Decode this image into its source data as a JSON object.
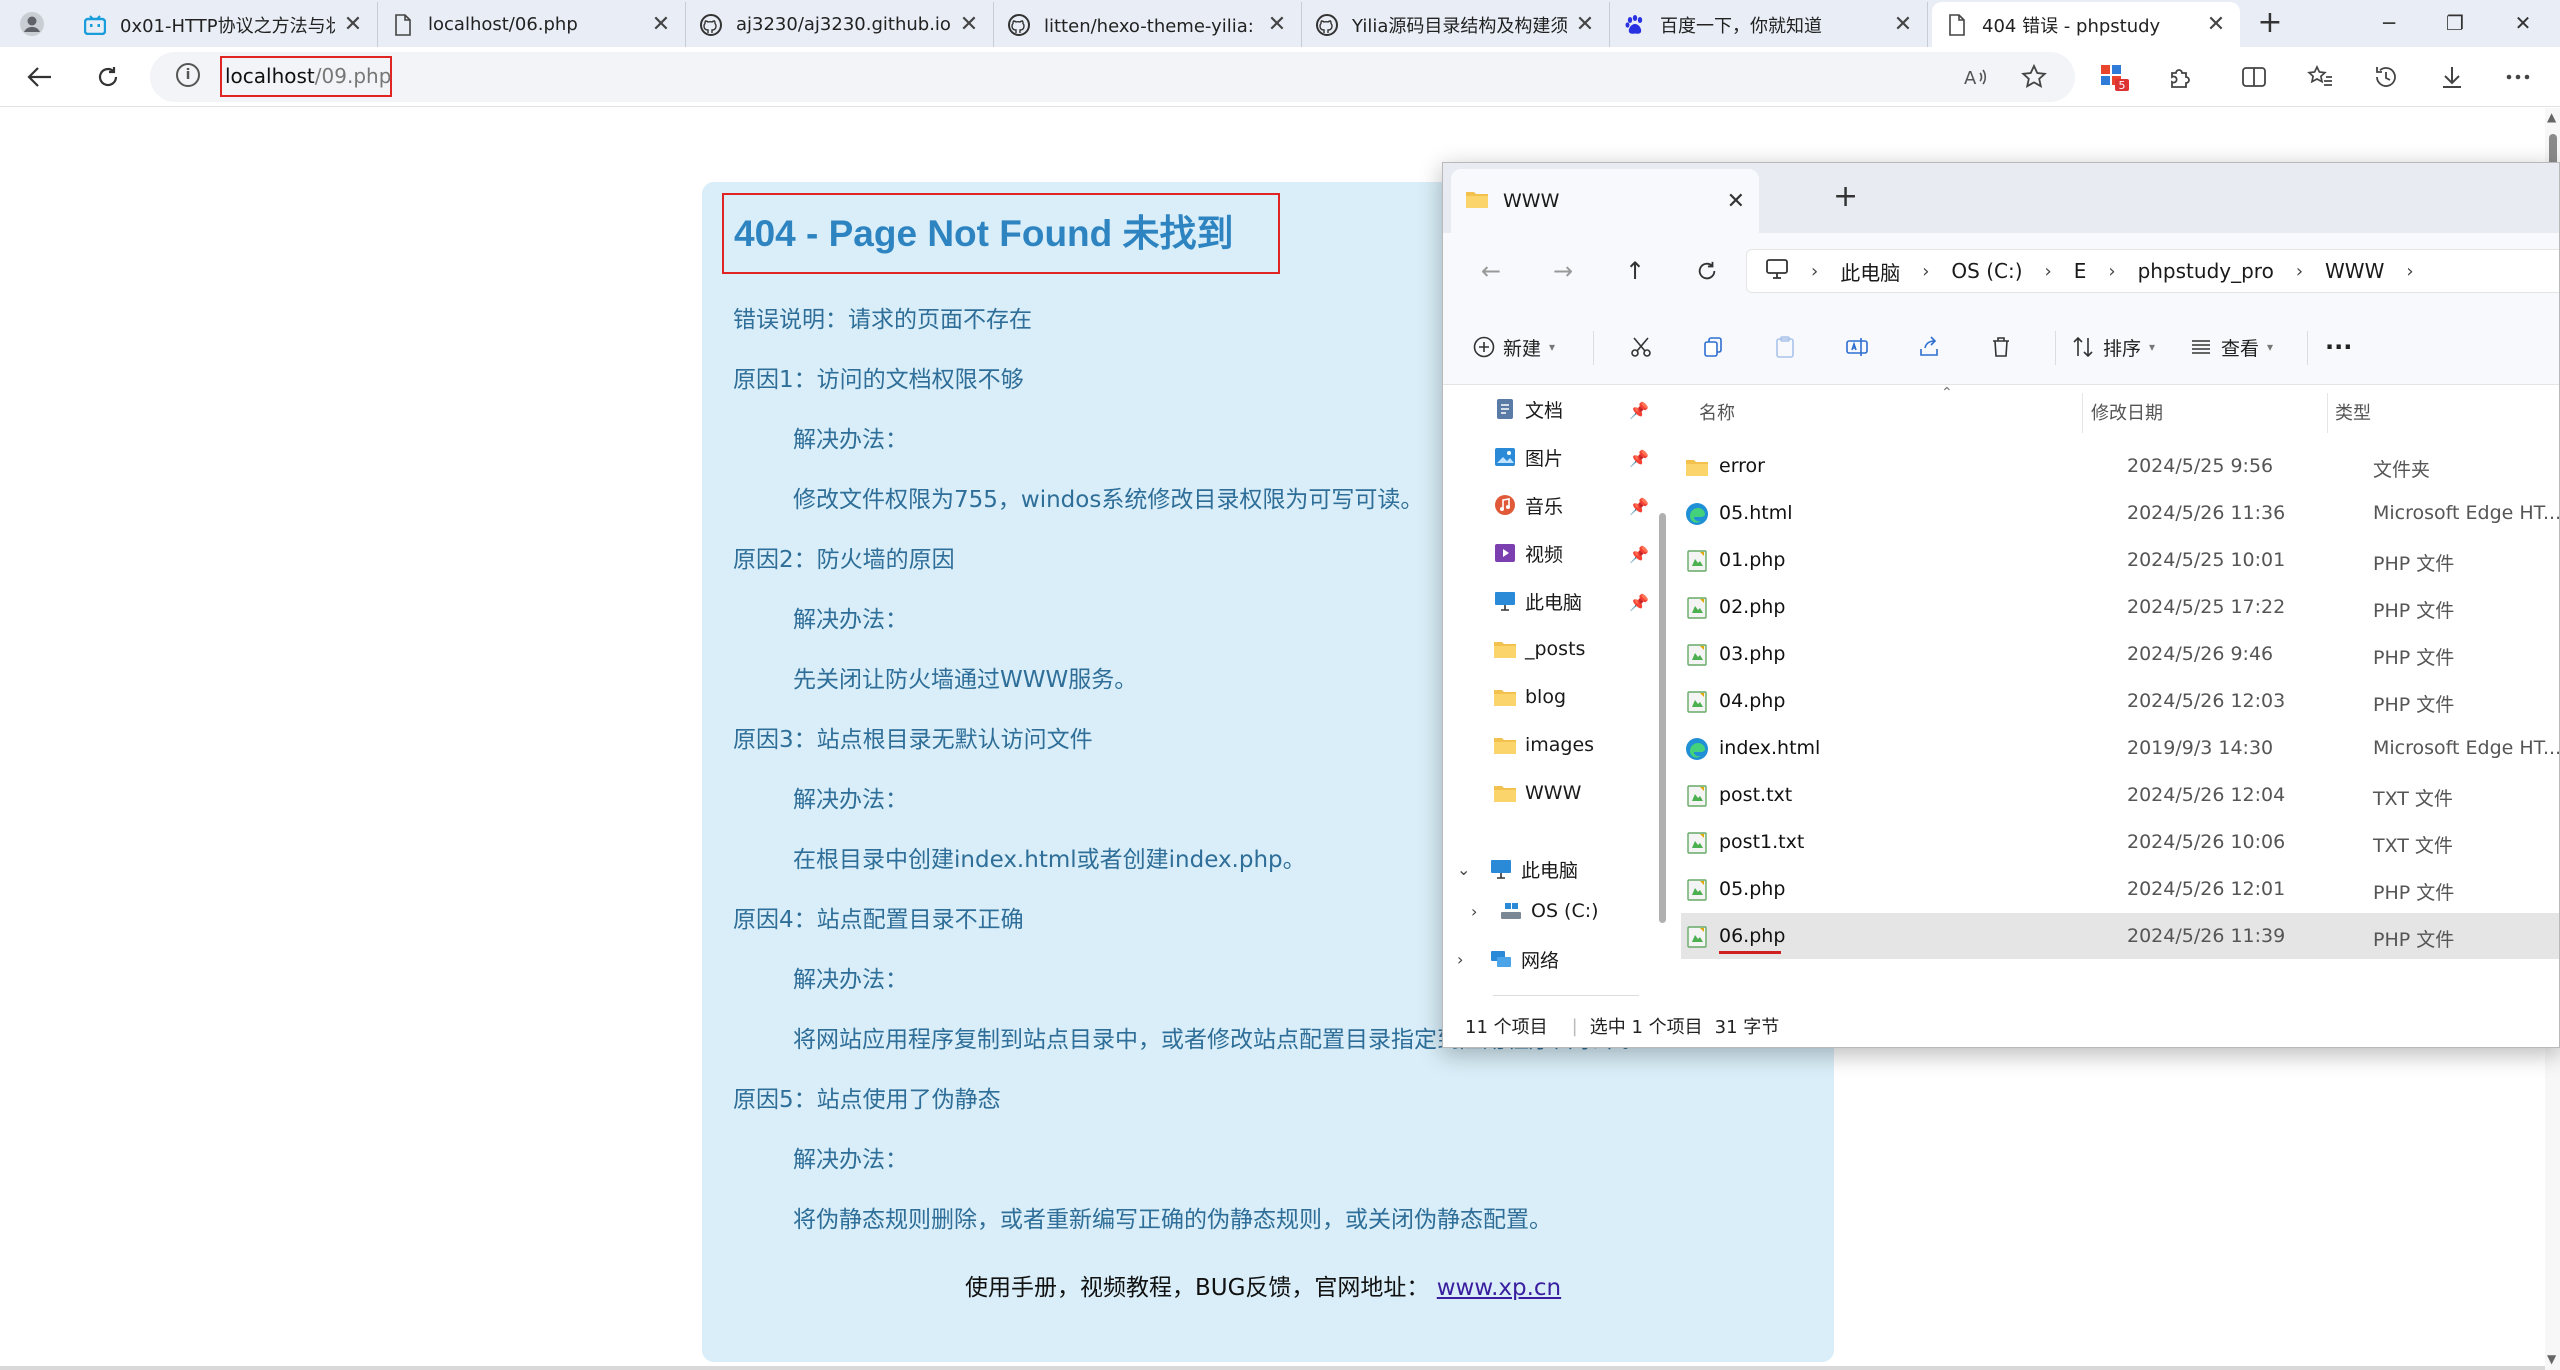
{
  "browser": {
    "tabs": [
      {
        "title": "0x01-HTTP协议之方法与状",
        "icon": "bilibili-icon"
      },
      {
        "title": "localhost/06.php",
        "icon": "page-icon"
      },
      {
        "title": "aj3230/aj3230.github.io: M",
        "icon": "github-icon"
      },
      {
        "title": "litten/hexo-theme-yilia: 一",
        "icon": "github-icon"
      },
      {
        "title": "Yilia源码目录结构及构建须",
        "icon": "github-icon"
      },
      {
        "title": "百度一下，你就知道",
        "icon": "baidu-icon"
      },
      {
        "title": "404 错误 - phpstudy",
        "icon": "page-icon",
        "active": true
      }
    ],
    "new_tab": "+",
    "window_controls": {
      "minimize": "─",
      "restore": "❐",
      "close": "✕"
    },
    "url": {
      "host": "localhost",
      "path": "/09.php"
    },
    "extension_badge": "5"
  },
  "page": {
    "title": "404 - Page Not Found 未找到",
    "lines": [
      "错误说明：请求的页面不存在",
      "原因1：访问的文档权限不够",
      "解决办法：",
      "修改文件权限为755，windos系统修改目录权限为可写可读。",
      "原因2：防火墙的原因",
      "解决办法：",
      "先关闭让防火墙通过WWW服务。",
      "原因3：站点根目录无默认访问文件",
      "解决办法：",
      "在根目录中创建index.html或者创建index.php。",
      "原因4：站点配置目录不正确",
      "解决办法：",
      "将网站应用程序复制到站点目录中，或者修改站点配置目录指定到应用程序目录中。",
      "原因5：站点使用了伪静态",
      "解决办法：",
      "将伪静态规则删除，或者重新编写正确的伪静态规则，或关闭伪静态配置。"
    ],
    "footer_text": "使用手册，视频教程，BUG反馈，官网地址：",
    "footer_link": "www.xp.cn"
  },
  "explorer": {
    "tab_title": "WWW",
    "new_tab": "+",
    "breadcrumb": [
      "此电脑",
      "OS (C:)",
      "E",
      "phpstudy_pro",
      "WWW"
    ],
    "commands": {
      "new": "新建",
      "sort": "排序",
      "view": "查看",
      "more": "···"
    },
    "sidebar": {
      "quick": [
        "文档",
        "图片",
        "音乐",
        "视频",
        "此电脑",
        "_posts",
        "blog",
        "images",
        "WWW"
      ],
      "tree": [
        "此电脑",
        "OS (C:)",
        "网络"
      ]
    },
    "columns": {
      "name": "名称",
      "date": "修改日期",
      "type": "类型"
    },
    "files": [
      {
        "name": "error",
        "date": "2024/5/25 9:56",
        "type": "文件夹",
        "icon": "folder-icon"
      },
      {
        "name": "05.html",
        "date": "2024/5/26 11:36",
        "type": "Microsoft Edge HT...",
        "icon": "edge-icon"
      },
      {
        "name": "01.php",
        "date": "2024/5/25 10:01",
        "type": "PHP 文件",
        "icon": "php-file-icon"
      },
      {
        "name": "02.php",
        "date": "2024/5/25 17:22",
        "type": "PHP 文件",
        "icon": "php-file-icon"
      },
      {
        "name": "03.php",
        "date": "2024/5/26 9:46",
        "type": "PHP 文件",
        "icon": "php-file-icon"
      },
      {
        "name": "04.php",
        "date": "2024/5/26 12:03",
        "type": "PHP 文件",
        "icon": "php-file-icon"
      },
      {
        "name": "index.html",
        "date": "2019/9/3 14:30",
        "type": "Microsoft Edge HT...",
        "icon": "edge-icon"
      },
      {
        "name": "post.txt",
        "date": "2024/5/26 12:04",
        "type": "TXT 文件",
        "icon": "txt-file-icon"
      },
      {
        "name": "post1.txt",
        "date": "2024/5/26 10:06",
        "type": "TXT 文件",
        "icon": "txt-file-icon"
      },
      {
        "name": "05.php",
        "date": "2024/5/26 12:01",
        "type": "PHP 文件",
        "icon": "php-file-icon"
      },
      {
        "name": "06.php",
        "date": "2024/5/26 11:39",
        "type": "PHP 文件",
        "icon": "php-file-icon",
        "selected": true
      }
    ],
    "status": {
      "count": "11 个项目",
      "selection": "选中 1 个项目",
      "size": "31 字节"
    }
  },
  "colors": {
    "accent": "#2e84c0",
    "highlight_box": "#e02424",
    "card_bg": "#d9eef8"
  }
}
